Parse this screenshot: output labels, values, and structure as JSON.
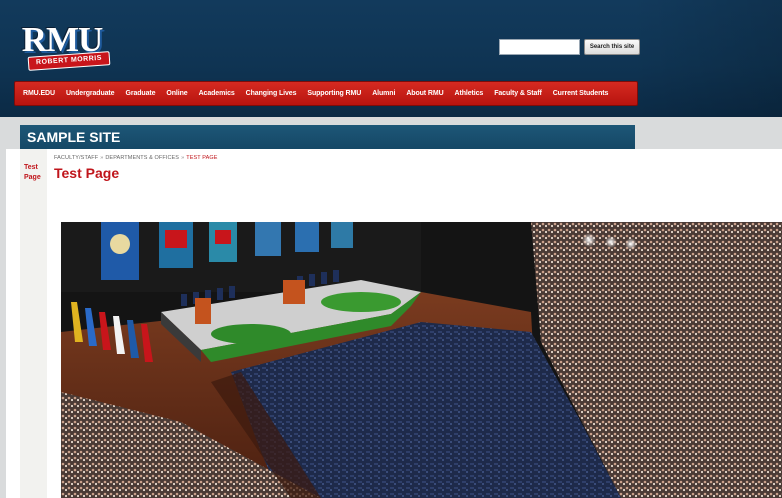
{
  "header": {
    "logo_text": "RMU",
    "logo_banner": "ROBERT MORRIS",
    "search": {
      "value": "",
      "button_label": "Search this site"
    }
  },
  "nav": {
    "items": [
      "RMU.EDU",
      "Undergraduate",
      "Graduate",
      "Online",
      "Academics",
      "Changing Lives",
      "Supporting RMU",
      "Alumni",
      "About RMU",
      "Athletics",
      "Faculty & Staff",
      "Current Students"
    ]
  },
  "site_title": "SAMPLE SITE",
  "sidebar": {
    "items": [
      "Test Page"
    ]
  },
  "breadcrumb": {
    "items": [
      "FACULTY/STAFF",
      "DEPARTMENTS & OFFICES"
    ],
    "separator": "»",
    "current": "TEST PAGE"
  },
  "page_title": "Test Page",
  "colors": {
    "header_blue": "#0f3453",
    "nav_red": "#c8151b",
    "accent_red": "#c0151b",
    "title_bar": "#1a5070",
    "band_gray": "#d9dbdc"
  }
}
